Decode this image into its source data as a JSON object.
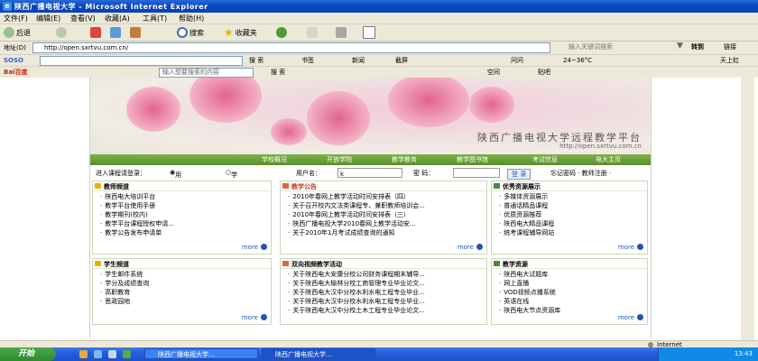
{
  "window": {
    "title": "陕西广播电视大学 - Microsoft Internet Explorer"
  },
  "menu": [
    "文件(F)",
    "编辑(E)",
    "查看(V)",
    "收藏(A)",
    "工具(T)",
    "帮助(H)"
  ],
  "toolbar": {
    "back": "后退",
    "search": "搜索",
    "favorites": "收藏夹"
  },
  "address": {
    "label": "地址(D)",
    "url": "http://open.sxrtvu.com.cn/",
    "search_placeholder": "输入关键词搜索",
    "go": "转到",
    "links": "链接"
  },
  "soso": {
    "logo": "SOSO",
    "search_btn": "搜 索",
    "items": [
      "书签",
      "新闻",
      "截屏",
      "问问",
      "24~36°C",
      "天上虹"
    ]
  },
  "baidu": {
    "logo": "Bai百度",
    "placeholder": "输入想要搜索的内容",
    "search_btn": "搜 索",
    "items": [
      "空间",
      "贴吧"
    ]
  },
  "site": {
    "title": "陕西广播电视大学远程教学平台",
    "url": "http://open.sxrtvu.com.cn",
    "nav": [
      "学校概况",
      "开放学院",
      "教学教务",
      "教学图书馆",
      "考试信息",
      "电大主页"
    ]
  },
  "login": {
    "prompt": "进入课程请登录：",
    "options": [
      "用户名登录",
      "学号登录"
    ],
    "user_label": "用户名：",
    "user_value": "k",
    "pass_label": "密  码：",
    "submit": "登 录",
    "links": "忘记密码 · 教师注册 ·"
  },
  "panels": {
    "teacher": {
      "title": "教师频道",
      "items": [
        "陕西电大培训平台",
        "教学平台使用手册",
        "教学期刊(校内)",
        "教学平台课程授权申请...",
        "教学公告发布申请单"
      ],
      "more": "more"
    },
    "notice": {
      "title": "教学公告",
      "items": [
        "2010年春网上教学活动时间安排表（四）",
        "关于召开校内文法类课程专、兼职教师培训会...",
        "2010年春网上教学活动时间安排表（三）",
        "陕西广播电视大学2010春网上教学活动安...",
        "关于2010年1月考试成绩查询的通知"
      ],
      "more": "more"
    },
    "resources": {
      "title": "优秀资源展示",
      "items": [
        "多媒体资源展示",
        "普通话精品课程",
        "优质资源推荐",
        "陕西电大精品课程",
        "统考课程辅导网站"
      ],
      "more": "more"
    },
    "student": {
      "title": "学生频道",
      "items": [
        "学生邮件系统",
        "学分及成绩查询",
        "高职教育",
        "思政园地"
      ],
      "more": "more"
    },
    "video": {
      "title": "双向视频教学活动",
      "items": [
        "关于陕西电大安康分校公司财务课程期末辅导...",
        "关于陕西电大榆林分校工商管理专业毕业论文...",
        "关于陕西电大汉中分校水利水电工程专业毕业...",
        "关于陕西电大汉中分校水利水电工程专业毕业...",
        "关于陕西电大汉中分校土木工程专业毕业论文..."
      ],
      "more": "more"
    },
    "edu": {
      "title": "教学资源",
      "items": [
        "陕西电大试题库",
        "网上直播",
        "VOD视频点播系统",
        "英语在线",
        "陕西电大节点资源库"
      ],
      "more": "more"
    }
  },
  "status": {
    "zone": "Internet"
  },
  "taskbar": {
    "start": "开始",
    "tasks": [
      "陕西广播电视大学...",
      "陕西广播电视大学..."
    ],
    "clock": "13:43"
  }
}
